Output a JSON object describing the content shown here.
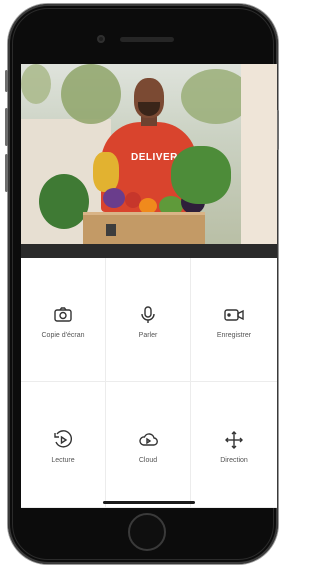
{
  "video": {
    "shirt_text": "DELIVER"
  },
  "controls": [
    {
      "label": "Copie d'écran",
      "icon": "camera-icon"
    },
    {
      "label": "Parler",
      "icon": "microphone-icon"
    },
    {
      "label": "Enregistrer",
      "icon": "video-camera-icon"
    },
    {
      "label": "Lecture",
      "icon": "playback-icon"
    },
    {
      "label": "Cloud",
      "icon": "cloud-play-icon"
    },
    {
      "label": "Direction",
      "icon": "move-arrows-icon"
    }
  ],
  "colors": {
    "shirt": "#d9442d",
    "icon": "#333333",
    "label": "#555555",
    "divider": "#ececec"
  }
}
